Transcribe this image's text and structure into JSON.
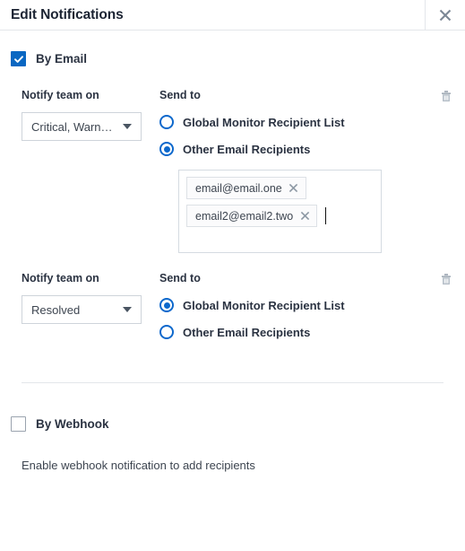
{
  "header": {
    "title": "Edit Notifications",
    "close_icon": "close-icon"
  },
  "email_section": {
    "checkbox_label": "By Email",
    "checked": true,
    "groups": [
      {
        "notify_label": "Notify team on",
        "select_value": "Critical, Warn…",
        "send_to_label": "Send to",
        "delete_icon": "trash-icon",
        "options": [
          {
            "label": "Global Monitor Recipient List",
            "selected": false
          },
          {
            "label": "Other Email Recipients",
            "selected": true
          }
        ],
        "recipients": [
          {
            "email": "email@email.one",
            "remove_icon": "close-icon"
          },
          {
            "email": "email2@email2.two",
            "remove_icon": "close-icon"
          }
        ]
      },
      {
        "notify_label": "Notify team on",
        "select_value": "Resolved",
        "send_to_label": "Send to",
        "delete_icon": "trash-icon",
        "options": [
          {
            "label": "Global Monitor Recipient List",
            "selected": true
          },
          {
            "label": "Other Email Recipients",
            "selected": false
          }
        ]
      }
    ]
  },
  "webhook_section": {
    "checkbox_label": "By Webhook",
    "checked": false,
    "note": "Enable webhook notification to add recipients"
  },
  "colors": {
    "accent_blue": "#0a67c2",
    "radio_blue": "#0d68cc",
    "text_dark": "#2b3342",
    "border_grey": "#e3e6ea"
  }
}
